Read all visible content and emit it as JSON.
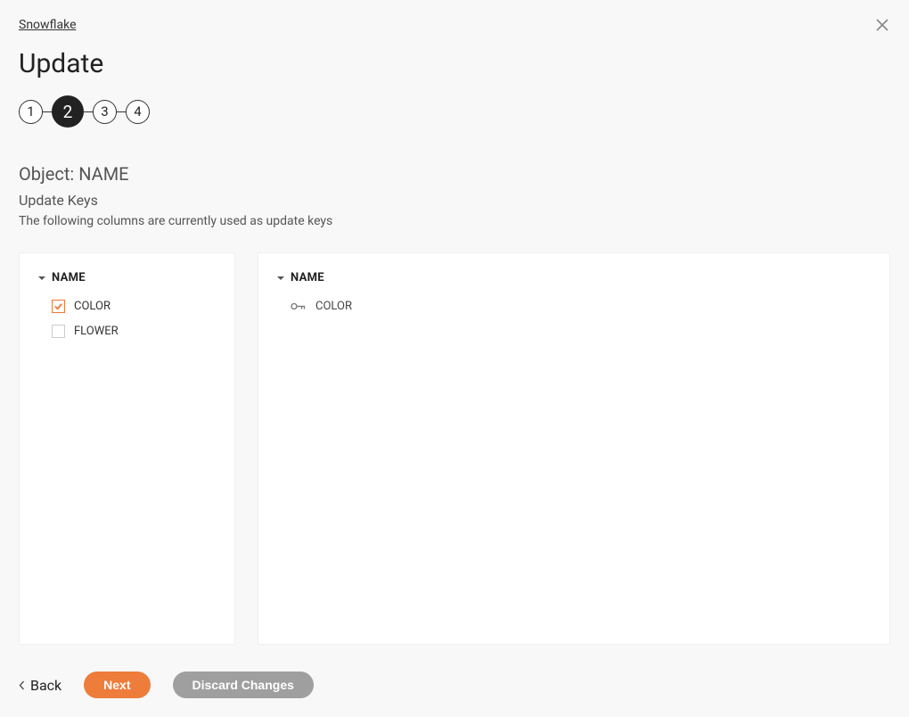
{
  "breadcrumb": "Snowflake",
  "title": "Update",
  "steps": [
    "1",
    "2",
    "3",
    "4"
  ],
  "active_step_index": 1,
  "section_title": "Object: NAME",
  "subtitle": "Update Keys",
  "description": "The following columns are currently used as update keys",
  "left_panel": {
    "group_label": "NAME",
    "items": [
      {
        "label": "COLOR",
        "checked": true
      },
      {
        "label": "FLOWER",
        "checked": false
      }
    ]
  },
  "right_panel": {
    "group_label": "NAME",
    "keys": [
      {
        "label": "COLOR"
      }
    ]
  },
  "footer": {
    "back_label": "Back",
    "next_label": "Next",
    "discard_label": "Discard Changes"
  }
}
